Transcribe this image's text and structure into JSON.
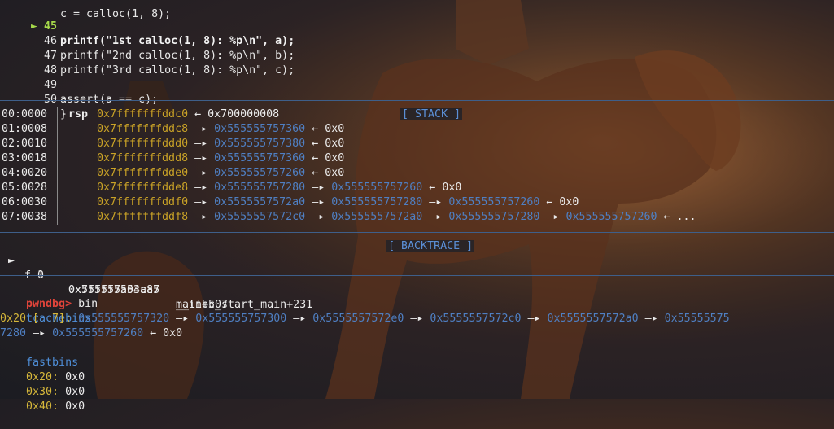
{
  "source": {
    "lines": [
      {
        "num": "45",
        "text": "printf(\"1st calloc(1, 8): %p\\n\", a);",
        "current": true
      },
      {
        "num": "46",
        "text": "printf(\"2nd calloc(1, 8): %p\\n\", b);",
        "current": false
      },
      {
        "num": "47",
        "text": "printf(\"3rd calloc(1, 8): %p\\n\", c);",
        "current": false
      },
      {
        "num": "48",
        "text": "",
        "current": false
      },
      {
        "num": "49",
        "text": "assert(a == c);",
        "current": false
      },
      {
        "num": "50",
        "text": "}",
        "current": false
      }
    ],
    "partial_top": "c = calloc(1, 8);"
  },
  "stack": {
    "header": "[ STACK ]",
    "rows": [
      {
        "idx": "00:0000",
        "reg": "rsp",
        "chain": [
          "0x7fffffffddc0",
          "← 0x700000008"
        ]
      },
      {
        "idx": "01:0008",
        "reg": "",
        "chain": [
          "0x7fffffffddc8",
          "0x555555757360",
          "← 0x0"
        ]
      },
      {
        "idx": "02:0010",
        "reg": "",
        "chain": [
          "0x7fffffffddd0",
          "0x555555757380",
          "← 0x0"
        ]
      },
      {
        "idx": "03:0018",
        "reg": "",
        "chain": [
          "0x7fffffffddd8",
          "0x555555757360",
          "← 0x0"
        ]
      },
      {
        "idx": "04:0020",
        "reg": "",
        "chain": [
          "0x7fffffffdde0",
          "0x555555757260",
          "← 0x0"
        ]
      },
      {
        "idx": "05:0028",
        "reg": "",
        "chain": [
          "0x7fffffffdde8",
          "0x555555757280",
          "0x555555757260",
          "← 0x0"
        ]
      },
      {
        "idx": "06:0030",
        "reg": "",
        "chain": [
          "0x7fffffffddf0",
          "0x5555557572a0",
          "0x555555757280",
          "0x555555757260",
          "← 0x0"
        ]
      },
      {
        "idx": "07:0038",
        "reg": "",
        "chain": [
          "0x7fffffffddf8",
          "0x5555557572c0",
          "0x5555557572a0",
          "0x555555757280",
          "0x555555757260",
          "← ..."
        ]
      }
    ]
  },
  "backtrace": {
    "header": "[ BACKTRACE ]",
    "frames": [
      {
        "marker": "►",
        "frame": "f 0",
        "addr": "0x555555554aa5",
        "sym": "main+507"
      },
      {
        "marker": "",
        "frame": "f 1",
        "addr": "0x7ffff7a03c87",
        "sym": "__libc_start_main+231"
      }
    ]
  },
  "console": {
    "prompt": "pwndbg>",
    "command": "bin",
    "tcache_label": "tcachebins",
    "tcache_line1_size": "0x20 [  7]:",
    "tcache_line1_chain": [
      "0x555555757320",
      "0x555555757300",
      "0x5555557572e0",
      "0x5555557572c0",
      "0x5555557572a0",
      "0x55555575"
    ],
    "tcache_line2_start": "7280",
    "tcache_line2_chain": [
      "0x555555757260"
    ],
    "tcache_line2_end": "← 0x0",
    "fastbins_label": "fastbins",
    "fastbins": [
      {
        "size": "0x20:",
        "val": "0x0"
      },
      {
        "size": "0x30:",
        "val": "0x0"
      },
      {
        "size": "0x40:",
        "val": "0x0"
      }
    ]
  },
  "colors": {
    "stack_addr": "#c9a227",
    "heap_addr": "#4f7fc2",
    "header": "#5b8fd6",
    "prompt": "#e0443a",
    "current_line_marker": "#a6d94a"
  }
}
